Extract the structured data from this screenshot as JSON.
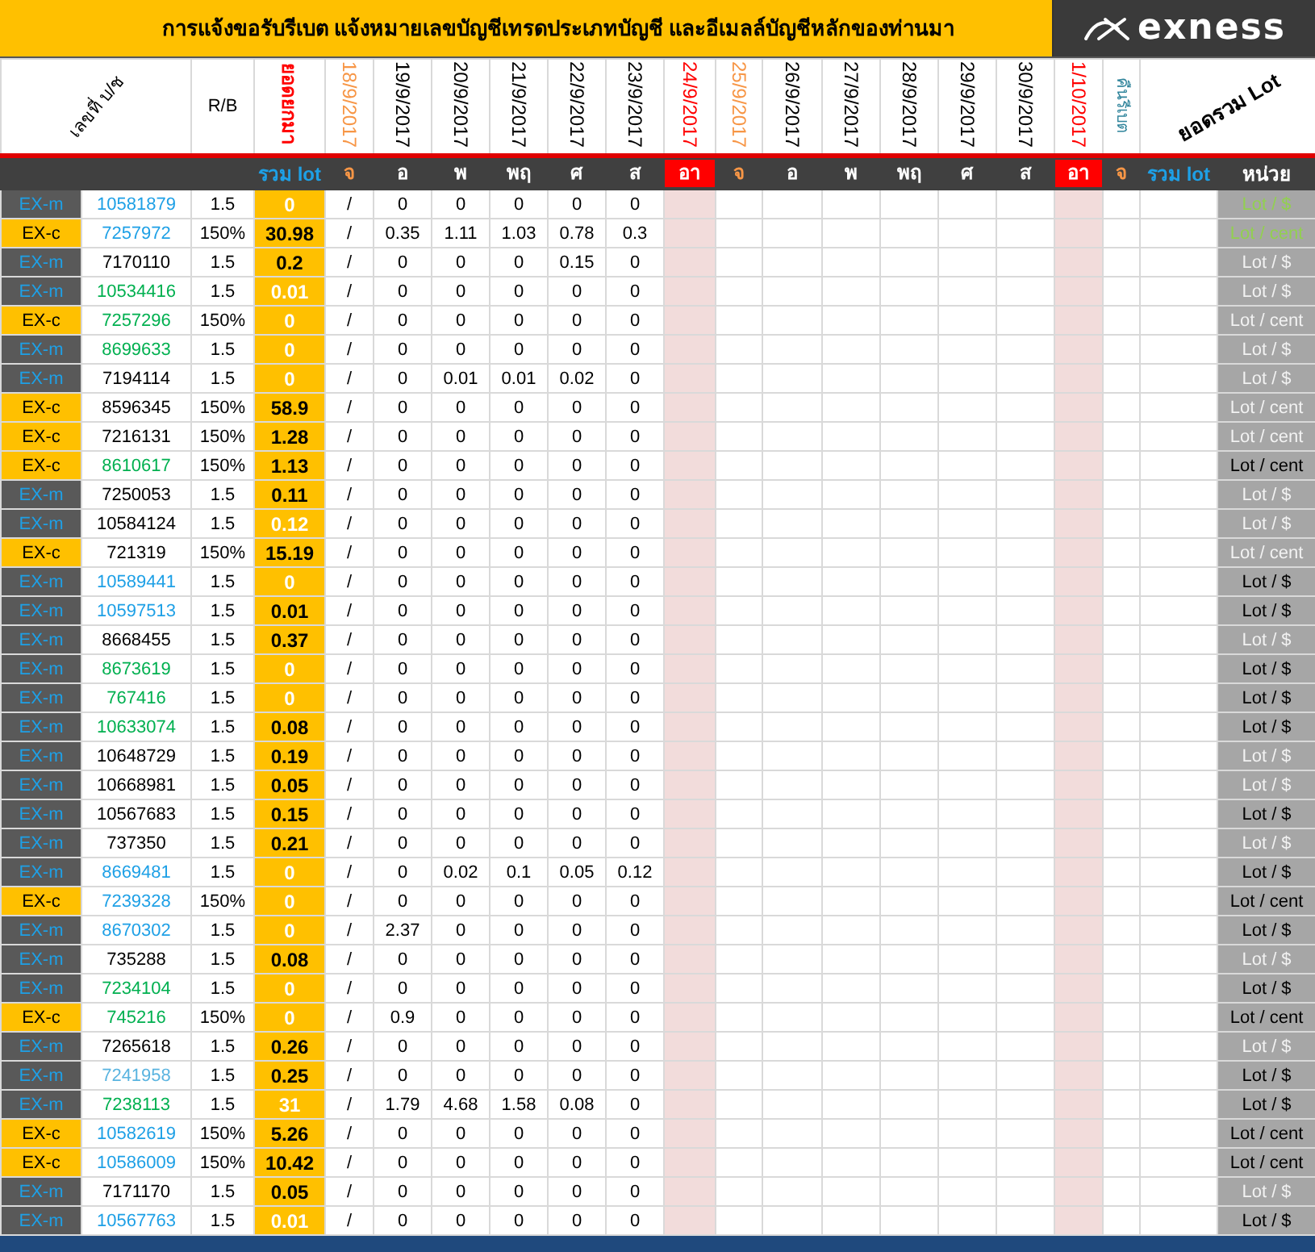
{
  "title": "การแจ้งขอรับรีเบต  แจ้งหมายเลขบัญชีเทรดประเภทบัญชี และอีเมลล์บัญชีหลักของท่านมา",
  "logo": "exness",
  "header": {
    "account_label": "เลขที่ บ/ช",
    "rb_label": "R/B",
    "carry_label": "ยอดยกมา",
    "rebate_label": "คืนรีเบต",
    "sum_label": "ยอดรวม Lot",
    "dates": [
      {
        "label": "18/9/2017",
        "color": "#f79646"
      },
      {
        "label": "19/9/2017",
        "color": "#000000"
      },
      {
        "label": "20/9/2017",
        "color": "#000000"
      },
      {
        "label": "21/9/2017",
        "color": "#000000"
      },
      {
        "label": "22/9/2017",
        "color": "#000000"
      },
      {
        "label": "23/9/2017",
        "color": "#000000"
      },
      {
        "label": "24/9/2017",
        "color": "#ff0000"
      },
      {
        "label": "25/9/2017",
        "color": "#f79646"
      },
      {
        "label": "26/9/2017",
        "color": "#000000"
      },
      {
        "label": "27/9/2017",
        "color": "#000000"
      },
      {
        "label": "28/9/2017",
        "color": "#000000"
      },
      {
        "label": "29/9/2017",
        "color": "#000000"
      },
      {
        "label": "30/9/2017",
        "color": "#000000"
      },
      {
        "label": "1/10/2017",
        "color": "#ff0000"
      }
    ],
    "days": [
      {
        "label": "จ",
        "color": "#f79646",
        "highlighted": false
      },
      {
        "label": "อ",
        "color": "#ffffff",
        "highlighted": false
      },
      {
        "label": "พ",
        "color": "#ffffff",
        "highlighted": false
      },
      {
        "label": "พฤ",
        "color": "#ffffff",
        "highlighted": false
      },
      {
        "label": "ศ",
        "color": "#ffffff",
        "highlighted": false
      },
      {
        "label": "ส",
        "color": "#ffffff",
        "highlighted": false
      },
      {
        "label": "อา",
        "highlighted": true
      },
      {
        "label": "จ",
        "color": "#f79646",
        "highlighted": false
      },
      {
        "label": "อ",
        "color": "#ffffff",
        "highlighted": false
      },
      {
        "label": "พ",
        "color": "#ffffff",
        "highlighted": false
      },
      {
        "label": "พฤ",
        "color": "#ffffff",
        "highlighted": false
      },
      {
        "label": "ศ",
        "color": "#ffffff",
        "highlighted": false
      },
      {
        "label": "ส",
        "color": "#ffffff",
        "highlighted": false
      },
      {
        "label": "อา",
        "highlighted": true
      },
      {
        "label": "จ",
        "color": "#f79646",
        "highlighted": false
      }
    ],
    "total_label": "รวม lot",
    "sum_total_label": "รวม lot",
    "unit_label": "หน่วย"
  },
  "rows": [
    {
      "kind": "m",
      "type": "EX-m",
      "account": "10581879",
      "color": "#1ea0e6",
      "rb": "1.5",
      "total": "0",
      "total_light": true,
      "mark": "/",
      "days": [
        "0",
        "0",
        "0",
        "0",
        "0"
      ],
      "unit": {
        "label": "Lot / $",
        "color": "#92d050"
      }
    },
    {
      "kind": "c",
      "type": "EX-c",
      "account": "7257972",
      "color": "#1ea0e6",
      "rb": "150%",
      "total": "30.98",
      "total_light": false,
      "mark": "/",
      "days": [
        "0.35",
        "1.11",
        "1.03",
        "0.78",
        "0.3"
      ],
      "unit": {
        "label": "Lot / cent",
        "color": "#92d050"
      }
    },
    {
      "kind": "m",
      "type": "EX-m",
      "account": "7170110",
      "color": "#000000",
      "rb": "1.5",
      "total": "0.2",
      "total_light": false,
      "mark": "/",
      "days": [
        "0",
        "0",
        "0",
        "0.15",
        "0"
      ],
      "unit": {
        "label": "Lot / $",
        "color": "#f2f2f2"
      }
    },
    {
      "kind": "m",
      "type": "EX-m",
      "account": "10534416",
      "color": "#00b050",
      "rb": "1.5",
      "total": "0.01",
      "total_light": true,
      "mark": "/",
      "days": [
        "0",
        "0",
        "0",
        "0",
        "0"
      ],
      "unit": {
        "label": "Lot / $",
        "color": "#f2f2f2"
      }
    },
    {
      "kind": "c",
      "type": "EX-c",
      "account": "7257296",
      "color": "#00b050",
      "rb": "150%",
      "total": "0",
      "total_light": true,
      "mark": "/",
      "days": [
        "0",
        "0",
        "0",
        "0",
        "0"
      ],
      "unit": {
        "label": "Lot / cent",
        "color": "#f2f2f2"
      }
    },
    {
      "kind": "m",
      "type": "EX-m",
      "account": "8699633",
      "color": "#00b050",
      "rb": "1.5",
      "total": "0",
      "total_light": true,
      "mark": "/",
      "days": [
        "0",
        "0",
        "0",
        "0",
        "0"
      ],
      "unit": {
        "label": "Lot / $",
        "color": "#f2f2f2"
      }
    },
    {
      "kind": "m",
      "type": "EX-m",
      "account": "7194114",
      "color": "#000000",
      "rb": "1.5",
      "total": "0",
      "total_light": true,
      "mark": "/",
      "days": [
        "0",
        "0.01",
        "0.01",
        "0.02",
        "0"
      ],
      "unit": {
        "label": "Lot / $",
        "color": "#f2f2f2"
      }
    },
    {
      "kind": "c",
      "type": "EX-c",
      "account": "8596345",
      "color": "#000000",
      "rb": "150%",
      "total": "58.9",
      "total_light": false,
      "mark": "/",
      "days": [
        "0",
        "0",
        "0",
        "0",
        "0"
      ],
      "unit": {
        "label": "Lot / cent",
        "color": "#f2f2f2"
      }
    },
    {
      "kind": "c",
      "type": "EX-c",
      "account": "7216131",
      "color": "#000000",
      "rb": "150%",
      "total": "1.28",
      "total_light": false,
      "mark": "/",
      "days": [
        "0",
        "0",
        "0",
        "0",
        "0"
      ],
      "unit": {
        "label": "Lot / cent",
        "color": "#f2f2f2"
      }
    },
    {
      "kind": "c",
      "type": "EX-c",
      "account": "8610617",
      "color": "#00b050",
      "rb": "150%",
      "total": "1.13",
      "total_light": false,
      "mark": "/",
      "days": [
        "0",
        "0",
        "0",
        "0",
        "0"
      ],
      "unit": {
        "label": "Lot / cent",
        "color": "#000000"
      }
    },
    {
      "kind": "m",
      "type": "EX-m",
      "account": "7250053",
      "color": "#000000",
      "rb": "1.5",
      "total": "0.11",
      "total_light": false,
      "mark": "/",
      "days": [
        "0",
        "0",
        "0",
        "0",
        "0"
      ],
      "unit": {
        "label": "Lot / $",
        "color": "#f2f2f2"
      }
    },
    {
      "kind": "m",
      "type": "EX-m",
      "account": "10584124",
      "color": "#000000",
      "rb": "1.5",
      "total": "0.12",
      "total_light": true,
      "mark": "/",
      "days": [
        "0",
        "0",
        "0",
        "0",
        "0"
      ],
      "unit": {
        "label": "Lot / $",
        "color": "#f2f2f2"
      }
    },
    {
      "kind": "c",
      "type": "EX-c",
      "account": "721319",
      "color": "#000000",
      "rb": "150%",
      "total": "15.19",
      "total_light": false,
      "mark": "/",
      "days": [
        "0",
        "0",
        "0",
        "0",
        "0"
      ],
      "unit": {
        "label": "Lot / cent",
        "color": "#f2f2f2"
      }
    },
    {
      "kind": "m",
      "type": "EX-m",
      "account": "10589441",
      "color": "#1ea0e6",
      "rb": "1.5",
      "total": "0",
      "total_light": true,
      "mark": "/",
      "days": [
        "0",
        "0",
        "0",
        "0",
        "0"
      ],
      "unit": {
        "label": "Lot / $",
        "color": "#000000"
      }
    },
    {
      "kind": "m",
      "type": "EX-m",
      "account": "10597513",
      "color": "#1ea0e6",
      "rb": "1.5",
      "total": "0.01",
      "total_light": false,
      "mark": "/",
      "days": [
        "0",
        "0",
        "0",
        "0",
        "0"
      ],
      "unit": {
        "label": "Lot / $",
        "color": "#000000"
      }
    },
    {
      "kind": "m",
      "type": "EX-m",
      "account": "8668455",
      "color": "#000000",
      "rb": "1.5",
      "total": "0.37",
      "total_light": false,
      "mark": "/",
      "days": [
        "0",
        "0",
        "0",
        "0",
        "0"
      ],
      "unit": {
        "label": "Lot / $",
        "color": "#f2f2f2"
      }
    },
    {
      "kind": "m",
      "type": "EX-m",
      "account": "8673619",
      "color": "#00b050",
      "rb": "1.5",
      "total": "0",
      "total_light": true,
      "mark": "/",
      "days": [
        "0",
        "0",
        "0",
        "0",
        "0"
      ],
      "unit": {
        "label": "Lot / $",
        "color": "#000000"
      }
    },
    {
      "kind": "m",
      "type": "EX-m",
      "account": "767416",
      "color": "#00b050",
      "rb": "1.5",
      "total": "0",
      "total_light": true,
      "mark": "/",
      "days": [
        "0",
        "0",
        "0",
        "0",
        "0"
      ],
      "unit": {
        "label": "Lot / $",
        "color": "#000000"
      }
    },
    {
      "kind": "m",
      "type": "EX-m",
      "account": "10633074",
      "color": "#00b050",
      "rb": "1.5",
      "total": "0.08",
      "total_light": false,
      "mark": "/",
      "days": [
        "0",
        "0",
        "0",
        "0",
        "0"
      ],
      "unit": {
        "label": "Lot / $",
        "color": "#000000"
      }
    },
    {
      "kind": "m",
      "type": "EX-m",
      "account": "10648729",
      "color": "#000000",
      "rb": "1.5",
      "total": "0.19",
      "total_light": false,
      "mark": "/",
      "days": [
        "0",
        "0",
        "0",
        "0",
        "0"
      ],
      "unit": {
        "label": "Lot / $",
        "color": "#f2f2f2"
      }
    },
    {
      "kind": "m",
      "type": "EX-m",
      "account": "10668981",
      "color": "#000000",
      "rb": "1.5",
      "total": "0.05",
      "total_light": false,
      "mark": "/",
      "days": [
        "0",
        "0",
        "0",
        "0",
        "0"
      ],
      "unit": {
        "label": "Lot / $",
        "color": "#f2f2f2"
      }
    },
    {
      "kind": "m",
      "type": "EX-m",
      "account": "10567683",
      "color": "#000000",
      "rb": "1.5",
      "total": "0.15",
      "total_light": false,
      "mark": "/",
      "days": [
        "0",
        "0",
        "0",
        "0",
        "0"
      ],
      "unit": {
        "label": "Lot / $",
        "color": "#000000"
      }
    },
    {
      "kind": "m",
      "type": "EX-m",
      "account": "737350",
      "color": "#000000",
      "rb": "1.5",
      "total": "0.21",
      "total_light": false,
      "mark": "/",
      "days": [
        "0",
        "0",
        "0",
        "0",
        "0"
      ],
      "unit": {
        "label": "Lot / $",
        "color": "#f2f2f2"
      }
    },
    {
      "kind": "m",
      "type": "EX-m",
      "account": "8669481",
      "color": "#1ea0e6",
      "rb": "1.5",
      "total": "0",
      "total_light": true,
      "mark": "/",
      "days": [
        "0",
        "0.02",
        "0.1",
        "0.05",
        "0.12"
      ],
      "unit": {
        "label": "Lot / $",
        "color": "#000000"
      }
    },
    {
      "kind": "c",
      "type": "EX-c",
      "account": "7239328",
      "color": "#1ea0e6",
      "rb": "150%",
      "total": "0",
      "total_light": true,
      "mark": "/",
      "days": [
        "0",
        "0",
        "0",
        "0",
        "0"
      ],
      "unit": {
        "label": "Lot / cent",
        "color": "#000000"
      }
    },
    {
      "kind": "m",
      "type": "EX-m",
      "account": "8670302",
      "color": "#1ea0e6",
      "rb": "1.5",
      "total": "0",
      "total_light": true,
      "mark": "/",
      "days": [
        "2.37",
        "0",
        "0",
        "0",
        "0"
      ],
      "unit": {
        "label": "Lot / $",
        "color": "#000000"
      }
    },
    {
      "kind": "m",
      "type": "EX-m",
      "account": "735288",
      "color": "#000000",
      "rb": "1.5",
      "total": "0.08",
      "total_light": false,
      "mark": "/",
      "days": [
        "0",
        "0",
        "0",
        "0",
        "0"
      ],
      "unit": {
        "label": "Lot / $",
        "color": "#f2f2f2"
      }
    },
    {
      "kind": "m",
      "type": "EX-m",
      "account": "7234104",
      "color": "#00b050",
      "rb": "1.5",
      "total": "0",
      "total_light": true,
      "mark": "/",
      "days": [
        "0",
        "0",
        "0",
        "0",
        "0"
      ],
      "unit": {
        "label": "Lot / $",
        "color": "#000000"
      }
    },
    {
      "kind": "c",
      "type": "EX-c",
      "account": "745216",
      "color": "#00b050",
      "rb": "150%",
      "total": "0",
      "total_light": true,
      "mark": "/",
      "days": [
        "0.9",
        "0",
        "0",
        "0",
        "0"
      ],
      "unit": {
        "label": "Lot / cent",
        "color": "#000000"
      }
    },
    {
      "kind": "m",
      "type": "EX-m",
      "account": "7265618",
      "color": "#000000",
      "rb": "1.5",
      "total": "0.26",
      "total_light": false,
      "mark": "/",
      "days": [
        "0",
        "0",
        "0",
        "0",
        "0"
      ],
      "unit": {
        "label": "Lot / $",
        "color": "#f2f2f2"
      }
    },
    {
      "kind": "m",
      "type": "EX-m",
      "account": "7241958",
      "color": "#5ab4e0",
      "rb": "1.5",
      "total": "0.25",
      "total_light": false,
      "mark": "/",
      "days": [
        "0",
        "0",
        "0",
        "0",
        "0"
      ],
      "unit": {
        "label": "Lot / $",
        "color": "#000000"
      }
    },
    {
      "kind": "m",
      "type": "EX-m",
      "account": "7238113",
      "color": "#00b050",
      "rb": "1.5",
      "total": "31",
      "total_light": true,
      "mark": "/",
      "days": [
        "1.79",
        "4.68",
        "1.58",
        "0.08",
        "0"
      ],
      "unit": {
        "label": "Lot / $",
        "color": "#000000"
      }
    },
    {
      "kind": "c",
      "type": "EX-c",
      "account": "10582619",
      "color": "#1ea0e6",
      "rb": "150%",
      "total": "5.26",
      "total_light": false,
      "mark": "/",
      "days": [
        "0",
        "0",
        "0",
        "0",
        "0"
      ],
      "unit": {
        "label": "Lot / cent",
        "color": "#000000"
      }
    },
    {
      "kind": "c",
      "type": "EX-c",
      "account": "10586009",
      "color": "#1ea0e6",
      "rb": "150%",
      "total": "10.42",
      "total_light": false,
      "mark": "/",
      "days": [
        "0",
        "0",
        "0",
        "0",
        "0"
      ],
      "unit": {
        "label": "Lot / cent",
        "color": "#000000"
      }
    },
    {
      "kind": "m",
      "type": "EX-m",
      "account": "7171170",
      "color": "#000000",
      "rb": "1.5",
      "total": "0.05",
      "total_light": false,
      "mark": "/",
      "days": [
        "0",
        "0",
        "0",
        "0",
        "0"
      ],
      "unit": {
        "label": "Lot / $",
        "color": "#f2f2f2"
      }
    },
    {
      "kind": "m",
      "type": "EX-m",
      "account": "10567763",
      "color": "#1ea0e6",
      "rb": "1.5",
      "total": "0.01",
      "total_light": true,
      "mark": "/",
      "days": [
        "0",
        "0",
        "0",
        "0",
        "0"
      ],
      "unit": {
        "label": "Lot / $",
        "color": "#000000"
      }
    }
  ]
}
